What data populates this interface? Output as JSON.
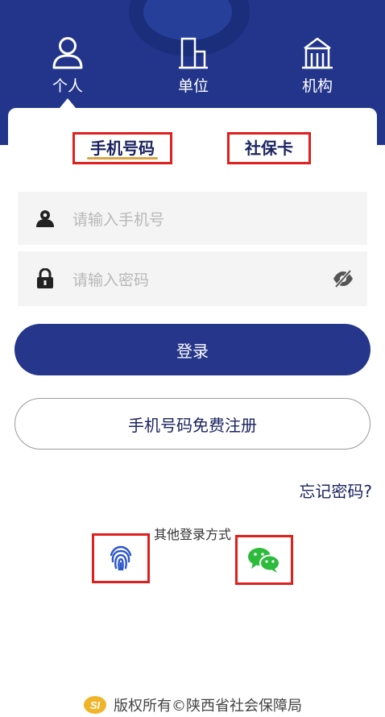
{
  "colors": {
    "brand_blue": "#22358b",
    "title_navy": "#1b2460",
    "accent_gold": "#d9a441",
    "highlight_red": "#e01f1f",
    "wechat_green": "#2dbb3c"
  },
  "role_tabs": [
    {
      "label": "个人",
      "icon": "person-icon",
      "active": true
    },
    {
      "label": "单位",
      "icon": "building-icon",
      "active": false
    },
    {
      "label": "机构",
      "icon": "institution-icon",
      "active": false
    }
  ],
  "login_tabs": [
    {
      "label": "手机号码",
      "active": true
    },
    {
      "label": "社保卡",
      "active": false
    }
  ],
  "form": {
    "phone_placeholder": "请输入手机号",
    "password_placeholder": "请输入密码"
  },
  "buttons": {
    "login": "登录",
    "register": "手机号码免费注册",
    "forgot": "忘记密码?"
  },
  "other_login": {
    "title": "其他登录方式",
    "methods": [
      "fingerprint-icon",
      "wechat-icon"
    ]
  },
  "footer": {
    "text": "版权所有©陕西省社会保障局",
    "icon": "si-logo-icon"
  }
}
